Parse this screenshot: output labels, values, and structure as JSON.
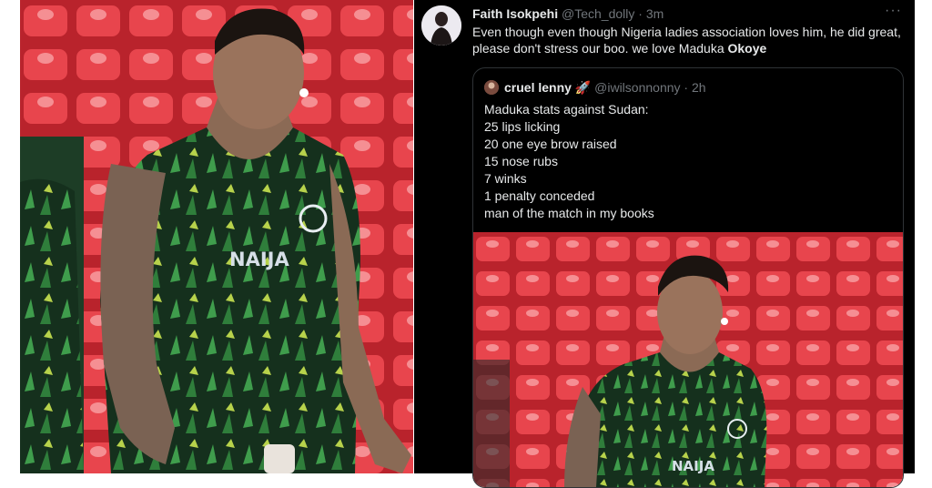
{
  "tweet": {
    "author_name": "Faith Isokpehi",
    "author_handle": "@Tech_dolly",
    "separator": "·",
    "time": "3m",
    "more_icon": "more-horizontal-icon",
    "text_before": "Even though even though Nigeria ladies association loves him, he did great, please don't stress our boo. we love Maduka ",
    "text_bold": "Okoye"
  },
  "quoted": {
    "author_name": "cruel lenny",
    "author_emoji": "🚀",
    "author_handle": "@iwilsonnonny",
    "separator": "·",
    "time": "2h",
    "lines": [
      "Maduka stats against Sudan:",
      "25 lips licking",
      "20 one eye brow raised",
      "15 nose rubs",
      "7 winks",
      "1 penalty conceded",
      "man of the match in my books"
    ]
  },
  "photos": {
    "jersey_text": "NAIJA"
  },
  "colors": {
    "stadium_red": "#d9363e",
    "jersey_green": "#1f5a2e",
    "panel_bg": "#000000"
  }
}
